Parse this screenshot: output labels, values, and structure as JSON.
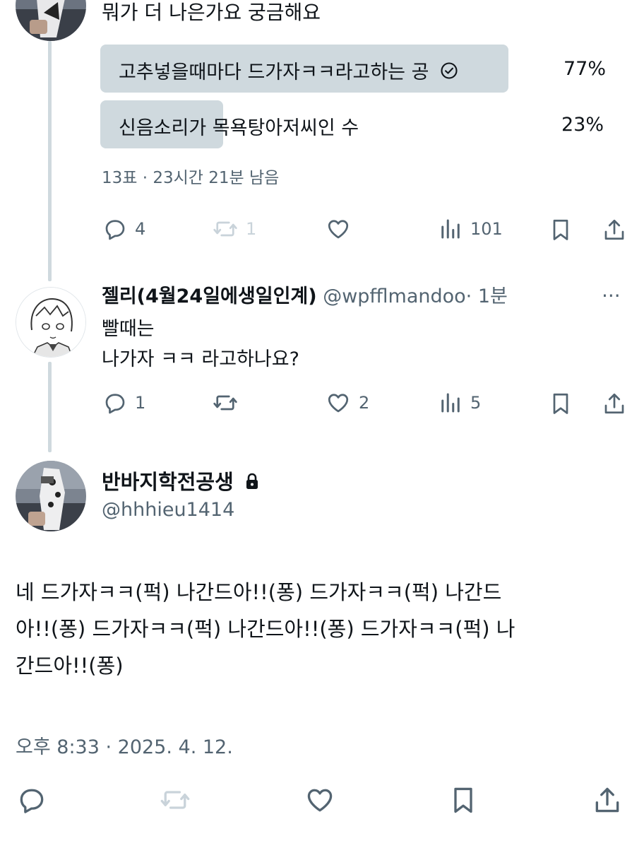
{
  "post1": {
    "text": "뭐가 더 나은가요 궁금해요",
    "poll": {
      "options": [
        {
          "label": "고추넣을때마다 드가자ㅋㅋ라고하는 공",
          "percent": "77%",
          "value": 0.77,
          "winner": true
        },
        {
          "label": "신음소리가 목욕탕아저씨인 수",
          "percent": "23%",
          "value": 0.23,
          "winner": false
        }
      ],
      "meta": "13표 · 23시간 21분 남음"
    },
    "actions": {
      "replies": "4",
      "reposts": "1",
      "likes": "",
      "views": "101"
    }
  },
  "reply": {
    "name": "젤리(4월24일에생일인계)",
    "handle": "@wpfflmandoo",
    "time": "· 1분",
    "more": "···",
    "line1": "빨때는",
    "line2": "나가자 ㅋㅋ 라고하나요?",
    "actions": {
      "replies": "1",
      "reposts": "",
      "likes": "2",
      "views": "5"
    }
  },
  "main": {
    "name": "반바지학전공생",
    "handle": "@hhhieu1414",
    "body": [
      "네 드가자ㅋㅋ(퍽) 나간드아!!(퐁) 드가자ㅋㅋ(퍽) 나간드",
      "아!!(퐁) 드가자ㅋㅋ(퍽) 나간드아!!(퐁) 드가자ㅋㅋ(퍽) 나",
      "간드아!!(퐁)"
    ],
    "timestamp": "오후 8:33 · 2025. 4. 12."
  },
  "colors": {
    "text": "#0f1419",
    "muted": "#536471",
    "faded": "#c9d3da",
    "poll": "#cfd9de",
    "thread": "#cfd9de"
  }
}
